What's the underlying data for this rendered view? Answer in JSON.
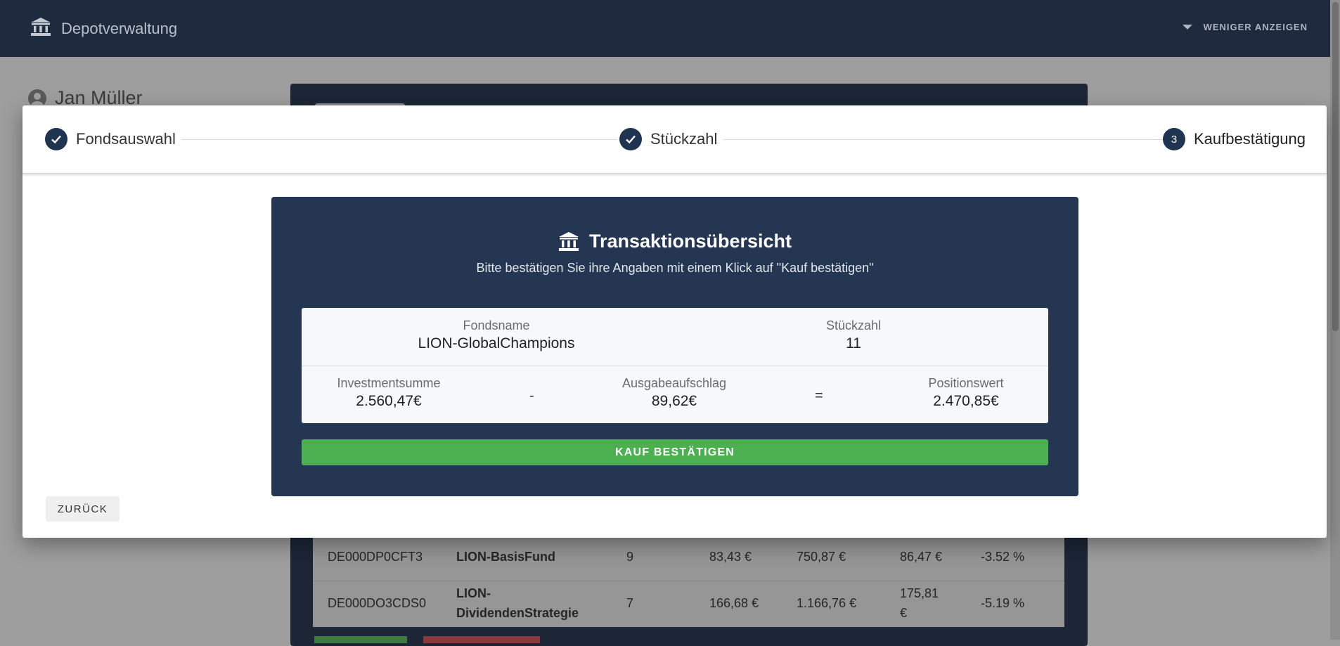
{
  "app": {
    "title": "Depotverwaltung",
    "toggle_label": "WENIGER ANZEIGEN"
  },
  "background": {
    "user_name": "Jan Müller",
    "rows": [
      {
        "isin": "DE000DP0CFT3",
        "name": "LION-BasisFund",
        "qty": "9",
        "price": "83,43 €",
        "value": "750,87 €",
        "buy": "86,47 €",
        "change": "-3.52 %"
      },
      {
        "isin": "DE000DO3CDS0",
        "name_line1": "LION-",
        "name_line2": "DividendenStrategie",
        "qty": "7",
        "price": "166,68 €",
        "value": "1.166,76 €",
        "buy_line1": "175,81",
        "buy_line2": "€",
        "change": "-5.19 %"
      }
    ]
  },
  "stepper": {
    "steps": [
      {
        "label": "Fondsauswahl",
        "state": "done"
      },
      {
        "label": "Stückzahl",
        "state": "done"
      },
      {
        "label": "Kaufbestätigung",
        "state": "active",
        "number": "3"
      }
    ]
  },
  "summary": {
    "title": "Transaktionsübersicht",
    "subtitle": "Bitte bestätigen Sie ihre Angaben mit einem Klick auf \"Kauf bestätigen\"",
    "fund_label": "Fondsname",
    "fund_value": "LION-GlobalChampions",
    "qty_label": "Stückzahl",
    "qty_value": "11",
    "invest_label": "Investmentsumme",
    "invest_value": "2.560,47€",
    "minus": "-",
    "fee_label": "Ausgabeaufschlag",
    "fee_value": "89,62€",
    "equals": "=",
    "position_label": "Positionswert",
    "position_value": "2.470,85€",
    "confirm_label": "KAUF BESTÄTIGEN"
  },
  "actions": {
    "back_label": "ZURÜCK"
  },
  "colors": {
    "topbar": "#1e2a3d",
    "card": "#243651",
    "step": "#1f3450",
    "confirm": "#4caf50"
  },
  "icons": {
    "brand": "bank-icon",
    "done": "check-icon",
    "caret": "caret-down-icon"
  }
}
